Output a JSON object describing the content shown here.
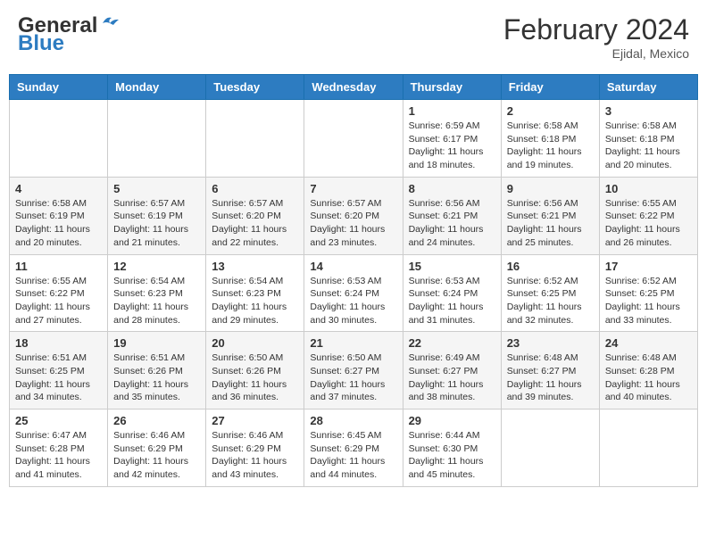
{
  "header": {
    "logo_general": "General",
    "logo_blue": "Blue",
    "month_year": "February 2024",
    "location": "Ejidal, Mexico"
  },
  "days_of_week": [
    "Sunday",
    "Monday",
    "Tuesday",
    "Wednesday",
    "Thursday",
    "Friday",
    "Saturday"
  ],
  "weeks": [
    [
      {
        "day": "",
        "info": ""
      },
      {
        "day": "",
        "info": ""
      },
      {
        "day": "",
        "info": ""
      },
      {
        "day": "",
        "info": ""
      },
      {
        "day": "1",
        "info": "Sunrise: 6:59 AM\nSunset: 6:17 PM\nDaylight: 11 hours and 18 minutes."
      },
      {
        "day": "2",
        "info": "Sunrise: 6:58 AM\nSunset: 6:18 PM\nDaylight: 11 hours and 19 minutes."
      },
      {
        "day": "3",
        "info": "Sunrise: 6:58 AM\nSunset: 6:18 PM\nDaylight: 11 hours and 20 minutes."
      }
    ],
    [
      {
        "day": "4",
        "info": "Sunrise: 6:58 AM\nSunset: 6:19 PM\nDaylight: 11 hours and 20 minutes."
      },
      {
        "day": "5",
        "info": "Sunrise: 6:57 AM\nSunset: 6:19 PM\nDaylight: 11 hours and 21 minutes."
      },
      {
        "day": "6",
        "info": "Sunrise: 6:57 AM\nSunset: 6:20 PM\nDaylight: 11 hours and 22 minutes."
      },
      {
        "day": "7",
        "info": "Sunrise: 6:57 AM\nSunset: 6:20 PM\nDaylight: 11 hours and 23 minutes."
      },
      {
        "day": "8",
        "info": "Sunrise: 6:56 AM\nSunset: 6:21 PM\nDaylight: 11 hours and 24 minutes."
      },
      {
        "day": "9",
        "info": "Sunrise: 6:56 AM\nSunset: 6:21 PM\nDaylight: 11 hours and 25 minutes."
      },
      {
        "day": "10",
        "info": "Sunrise: 6:55 AM\nSunset: 6:22 PM\nDaylight: 11 hours and 26 minutes."
      }
    ],
    [
      {
        "day": "11",
        "info": "Sunrise: 6:55 AM\nSunset: 6:22 PM\nDaylight: 11 hours and 27 minutes."
      },
      {
        "day": "12",
        "info": "Sunrise: 6:54 AM\nSunset: 6:23 PM\nDaylight: 11 hours and 28 minutes."
      },
      {
        "day": "13",
        "info": "Sunrise: 6:54 AM\nSunset: 6:23 PM\nDaylight: 11 hours and 29 minutes."
      },
      {
        "day": "14",
        "info": "Sunrise: 6:53 AM\nSunset: 6:24 PM\nDaylight: 11 hours and 30 minutes."
      },
      {
        "day": "15",
        "info": "Sunrise: 6:53 AM\nSunset: 6:24 PM\nDaylight: 11 hours and 31 minutes."
      },
      {
        "day": "16",
        "info": "Sunrise: 6:52 AM\nSunset: 6:25 PM\nDaylight: 11 hours and 32 minutes."
      },
      {
        "day": "17",
        "info": "Sunrise: 6:52 AM\nSunset: 6:25 PM\nDaylight: 11 hours and 33 minutes."
      }
    ],
    [
      {
        "day": "18",
        "info": "Sunrise: 6:51 AM\nSunset: 6:25 PM\nDaylight: 11 hours and 34 minutes."
      },
      {
        "day": "19",
        "info": "Sunrise: 6:51 AM\nSunset: 6:26 PM\nDaylight: 11 hours and 35 minutes."
      },
      {
        "day": "20",
        "info": "Sunrise: 6:50 AM\nSunset: 6:26 PM\nDaylight: 11 hours and 36 minutes."
      },
      {
        "day": "21",
        "info": "Sunrise: 6:50 AM\nSunset: 6:27 PM\nDaylight: 11 hours and 37 minutes."
      },
      {
        "day": "22",
        "info": "Sunrise: 6:49 AM\nSunset: 6:27 PM\nDaylight: 11 hours and 38 minutes."
      },
      {
        "day": "23",
        "info": "Sunrise: 6:48 AM\nSunset: 6:27 PM\nDaylight: 11 hours and 39 minutes."
      },
      {
        "day": "24",
        "info": "Sunrise: 6:48 AM\nSunset: 6:28 PM\nDaylight: 11 hours and 40 minutes."
      }
    ],
    [
      {
        "day": "25",
        "info": "Sunrise: 6:47 AM\nSunset: 6:28 PM\nDaylight: 11 hours and 41 minutes."
      },
      {
        "day": "26",
        "info": "Sunrise: 6:46 AM\nSunset: 6:29 PM\nDaylight: 11 hours and 42 minutes."
      },
      {
        "day": "27",
        "info": "Sunrise: 6:46 AM\nSunset: 6:29 PM\nDaylight: 11 hours and 43 minutes."
      },
      {
        "day": "28",
        "info": "Sunrise: 6:45 AM\nSunset: 6:29 PM\nDaylight: 11 hours and 44 minutes."
      },
      {
        "day": "29",
        "info": "Sunrise: 6:44 AM\nSunset: 6:30 PM\nDaylight: 11 hours and 45 minutes."
      },
      {
        "day": "",
        "info": ""
      },
      {
        "day": "",
        "info": ""
      }
    ]
  ]
}
